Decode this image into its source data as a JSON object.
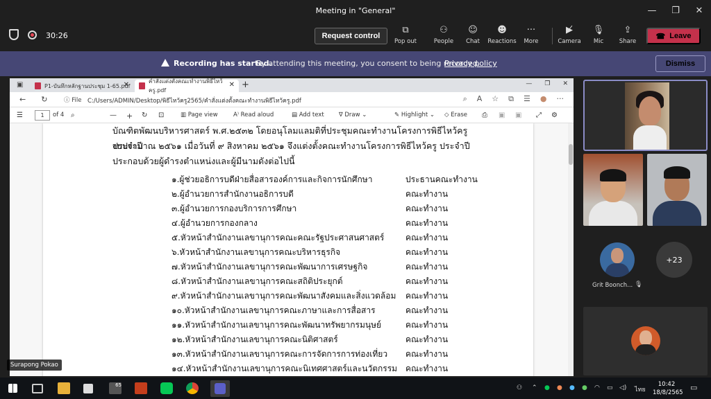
{
  "window": {
    "title": "Meeting in \"General\""
  },
  "toolbar": {
    "timer": "30:26",
    "request_control": "Request control",
    "popout": "Pop out",
    "people": "People",
    "chat": "Chat",
    "reactions": "Reactions",
    "more": "More",
    "camera": "Camera",
    "mic": "Mic",
    "share": "Share",
    "leave": "Leave"
  },
  "banner": {
    "title": "Recording has started.",
    "text": "By attending this meeting, you consent to being recorded.",
    "link": "Privacy policy",
    "dismiss": "Dismiss"
  },
  "browser": {
    "tab1": "P1-บันทึกหลักฐานประชุม 1-65.pdf",
    "tab2": "คำสั่งแต่งตั้งคณะทำงานพิธีไหว้ครู.pdf",
    "file_label": "File",
    "url": "C:/Users/ADMIN/Desktop/พิธีไหว้ครู2565/คำสั่งแต่งตั้งคณะทำงานพิธีไหว้ครู.pdf",
    "page_num": "1",
    "page_total": "of 4",
    "page_view": "Page view",
    "read_aloud": "Read aloud",
    "add_text": "Add text",
    "draw": "Draw",
    "highlight": "Highlight",
    "erase": "Erase"
  },
  "document": {
    "para1": "บัณฑิตพัฒนบริหารศาสตร์ พ.ศ.๒๕๓๒ โดยอนุโลมแลมติที่ประชุมคณะทำงานโครงการพิธีไหว้ครู ประจำปี",
    "para2": "งบประมาณ ๒๕๖๑ เมื่อวันที่ ๙ สิงหาคม ๒๕๖๑ จึงแต่งตั้งคณะทำงานโครงการพิธีไหว้ครู ประจำปี",
    "para3": "ประกอบด้วยผู้ดำรงตำแหน่งและผู้มีนามดังต่อไปนี้",
    "rows": [
      {
        "name": "๑.ผู้ช่วยอธิการบดีฝ่ายสื่อสารองค์การและกิจการนักศึกษา",
        "role": "ประธานคณะทำงาน"
      },
      {
        "name": "๒.ผู้อำนวยการสำนักงานอธิการบดี",
        "role": "คณะทำงาน"
      },
      {
        "name": "๓.ผู้อำนวยการกองบริการการศึกษา",
        "role": "คณะทำงาน"
      },
      {
        "name": "๔.ผู้อำนวยการกองกลาง",
        "role": "คณะทำงาน"
      },
      {
        "name": "๕.หัวหน้าสำนักงานเลขานุการคณะคณะรัฐประศาสนศาสตร์",
        "role": "คณะทำงาน"
      },
      {
        "name": "๖.หัวหน้าสำนักงานเลขานุการคณะบริหารธุรกิจ",
        "role": "คณะทำงาน"
      },
      {
        "name": "๗.หัวหน้าสำนักงานเลขานุการคณะพัฒนาการเศรษฐกิจ",
        "role": "คณะทำงาน"
      },
      {
        "name": "๘.หัวหน้าสำนักงานเลขานุการคณะสถิติประยุกต์",
        "role": "คณะทำงาน"
      },
      {
        "name": "๙.หัวหน้าสำนักงานเลขานุการคณะพัฒนาสังคมและสิ่งแวดล้อม",
        "role": "คณะทำงาน"
      },
      {
        "name": "๑๐.หัวหน้าสำนักงานเลขานุการคณะภาษาและการสื่อสาร",
        "role": "คณะทำงาน"
      },
      {
        "name": "๑๑.หัวหน้าสำนักงานเลขานุการคณะพัฒนาทรัพยากรมนุษย์",
        "role": "คณะทำงาน"
      },
      {
        "name": "๑๒.หัวหน้าสำนักงานเลขานุการคณะนิติศาสตร์",
        "role": "คณะทำงาน"
      },
      {
        "name": "๑๓.หัวหน้าสำนักงานเลขานุการคณะการจัดการการท่องเที่ยว",
        "role": "คณะทำงาน"
      },
      {
        "name": "๑๔.หัวหน้าสำนักงานเลขานุการคณะนิเทศศาสตร์และนวัตกรรม",
        "role": "คณะทำงาน"
      }
    ]
  },
  "presenter_caption": "Surapong Pokao",
  "participants": {
    "name": "Grit Boonch...",
    "overflow": "+23"
  },
  "taskbar": {
    "lang": "ไทย",
    "time": "10:42",
    "date": "18/8/2565",
    "badge": "65"
  },
  "colors": {
    "leave": "#c4314b",
    "banner": "#464775",
    "active_border": "#8b8cc7"
  }
}
